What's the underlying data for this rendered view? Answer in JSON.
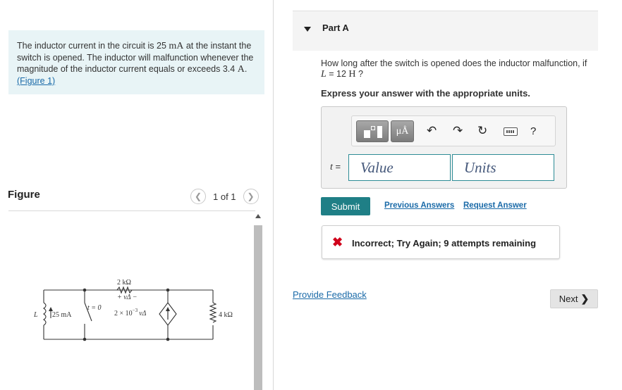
{
  "problem": {
    "text_1": "The inductor current in the circuit is 25 ",
    "unit_ma": "mA",
    "text_2": " at the instant the switch is opened. The inductor will malfunction whenever the magnitude of the inductor current equals or exceeds 3.4 ",
    "unit_a": "A",
    "text_3": ". ",
    "figure_link": "(Figure 1)"
  },
  "figure": {
    "title": "Figure",
    "counter": "1 of 1",
    "prev_icon": "chevron-left-icon",
    "next_icon": "chevron-right-icon",
    "circuit": {
      "resistor_top": "2 kΩ",
      "v_delta_label": "+ vΔ −",
      "inductor_label": "L",
      "current_label": "25 mA",
      "switch_label": "t = 0",
      "dependent_source": "2 × 10",
      "dependent_exp": "−3",
      "dependent_var": "vΔ",
      "resistor_right": "4 kΩ"
    }
  },
  "part": {
    "title": "Part A",
    "question_1": "How long after the switch is opened does the inductor malfunction, if ",
    "question_var": "L",
    "question_2": " = 12 ",
    "question_unit": "H",
    "question_3": " ?",
    "express": "Express your answer with the appropriate units."
  },
  "answer": {
    "toolbar": {
      "units_label": "μÅ",
      "undo_icon": "undo-icon",
      "redo_icon": "redo-icon",
      "reset_icon": "reset-icon",
      "keyboard_icon": "keyboard-icon",
      "help_label": "?"
    },
    "var_label": "t",
    "equals": " =",
    "value_placeholder": "Value",
    "units_placeholder": "Units"
  },
  "actions": {
    "submit": "Submit",
    "previous_answers": "Previous Answers",
    "request_answer": "Request Answer"
  },
  "feedback": {
    "status": "Incorrect; Try Again; 9 attempts remaining"
  },
  "footer": {
    "provide_feedback": "Provide Feedback",
    "next": "Next"
  },
  "colors": {
    "accent": "#1f7f86",
    "link": "#1a6aa8",
    "error": "#d0021b",
    "problem_bg": "#e8f4f6"
  }
}
